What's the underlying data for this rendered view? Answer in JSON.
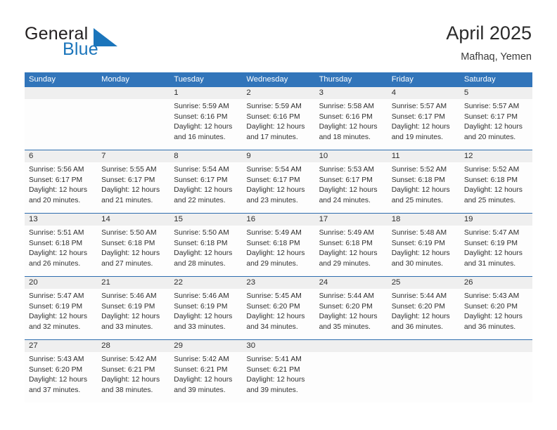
{
  "brand": {
    "name_part1": "General",
    "name_part2": "Blue",
    "mark_color": "#1b75bb"
  },
  "header": {
    "title": "April 2025",
    "location": "Mafhaq, Yemen"
  },
  "theme": {
    "header_blue": "#3275ba",
    "row_divider_blue": "#2e6daf",
    "datebar_gray": "#efefef",
    "cell_white": "#fdfdfd",
    "text": "#2f2f2f"
  },
  "weekdays": [
    "Sunday",
    "Monday",
    "Tuesday",
    "Wednesday",
    "Thursday",
    "Friday",
    "Saturday"
  ],
  "weeks": [
    [
      {
        "day": "",
        "lines": [
          "",
          "",
          "",
          ""
        ]
      },
      {
        "day": "",
        "lines": [
          "",
          "",
          "",
          ""
        ]
      },
      {
        "day": "1",
        "lines": [
          "Sunrise: 5:59 AM",
          "Sunset: 6:16 PM",
          "Daylight: 12 hours",
          "and 16 minutes."
        ]
      },
      {
        "day": "2",
        "lines": [
          "Sunrise: 5:59 AM",
          "Sunset: 6:16 PM",
          "Daylight: 12 hours",
          "and 17 minutes."
        ]
      },
      {
        "day": "3",
        "lines": [
          "Sunrise: 5:58 AM",
          "Sunset: 6:16 PM",
          "Daylight: 12 hours",
          "and 18 minutes."
        ]
      },
      {
        "day": "4",
        "lines": [
          "Sunrise: 5:57 AM",
          "Sunset: 6:17 PM",
          "Daylight: 12 hours",
          "and 19 minutes."
        ]
      },
      {
        "day": "5",
        "lines": [
          "Sunrise: 5:57 AM",
          "Sunset: 6:17 PM",
          "Daylight: 12 hours",
          "and 20 minutes."
        ]
      }
    ],
    [
      {
        "day": "6",
        "lines": [
          "Sunrise: 5:56 AM",
          "Sunset: 6:17 PM",
          "Daylight: 12 hours",
          "and 20 minutes."
        ]
      },
      {
        "day": "7",
        "lines": [
          "Sunrise: 5:55 AM",
          "Sunset: 6:17 PM",
          "Daylight: 12 hours",
          "and 21 minutes."
        ]
      },
      {
        "day": "8",
        "lines": [
          "Sunrise: 5:54 AM",
          "Sunset: 6:17 PM",
          "Daylight: 12 hours",
          "and 22 minutes."
        ]
      },
      {
        "day": "9",
        "lines": [
          "Sunrise: 5:54 AM",
          "Sunset: 6:17 PM",
          "Daylight: 12 hours",
          "and 23 minutes."
        ]
      },
      {
        "day": "10",
        "lines": [
          "Sunrise: 5:53 AM",
          "Sunset: 6:17 PM",
          "Daylight: 12 hours",
          "and 24 minutes."
        ]
      },
      {
        "day": "11",
        "lines": [
          "Sunrise: 5:52 AM",
          "Sunset: 6:18 PM",
          "Daylight: 12 hours",
          "and 25 minutes."
        ]
      },
      {
        "day": "12",
        "lines": [
          "Sunrise: 5:52 AM",
          "Sunset: 6:18 PM",
          "Daylight: 12 hours",
          "and 25 minutes."
        ]
      }
    ],
    [
      {
        "day": "13",
        "lines": [
          "Sunrise: 5:51 AM",
          "Sunset: 6:18 PM",
          "Daylight: 12 hours",
          "and 26 minutes."
        ]
      },
      {
        "day": "14",
        "lines": [
          "Sunrise: 5:50 AM",
          "Sunset: 6:18 PM",
          "Daylight: 12 hours",
          "and 27 minutes."
        ]
      },
      {
        "day": "15",
        "lines": [
          "Sunrise: 5:50 AM",
          "Sunset: 6:18 PM",
          "Daylight: 12 hours",
          "and 28 minutes."
        ]
      },
      {
        "day": "16",
        "lines": [
          "Sunrise: 5:49 AM",
          "Sunset: 6:18 PM",
          "Daylight: 12 hours",
          "and 29 minutes."
        ]
      },
      {
        "day": "17",
        "lines": [
          "Sunrise: 5:49 AM",
          "Sunset: 6:18 PM",
          "Daylight: 12 hours",
          "and 29 minutes."
        ]
      },
      {
        "day": "18",
        "lines": [
          "Sunrise: 5:48 AM",
          "Sunset: 6:19 PM",
          "Daylight: 12 hours",
          "and 30 minutes."
        ]
      },
      {
        "day": "19",
        "lines": [
          "Sunrise: 5:47 AM",
          "Sunset: 6:19 PM",
          "Daylight: 12 hours",
          "and 31 minutes."
        ]
      }
    ],
    [
      {
        "day": "20",
        "lines": [
          "Sunrise: 5:47 AM",
          "Sunset: 6:19 PM",
          "Daylight: 12 hours",
          "and 32 minutes."
        ]
      },
      {
        "day": "21",
        "lines": [
          "Sunrise: 5:46 AM",
          "Sunset: 6:19 PM",
          "Daylight: 12 hours",
          "and 33 minutes."
        ]
      },
      {
        "day": "22",
        "lines": [
          "Sunrise: 5:46 AM",
          "Sunset: 6:19 PM",
          "Daylight: 12 hours",
          "and 33 minutes."
        ]
      },
      {
        "day": "23",
        "lines": [
          "Sunrise: 5:45 AM",
          "Sunset: 6:20 PM",
          "Daylight: 12 hours",
          "and 34 minutes."
        ]
      },
      {
        "day": "24",
        "lines": [
          "Sunrise: 5:44 AM",
          "Sunset: 6:20 PM",
          "Daylight: 12 hours",
          "and 35 minutes."
        ]
      },
      {
        "day": "25",
        "lines": [
          "Sunrise: 5:44 AM",
          "Sunset: 6:20 PM",
          "Daylight: 12 hours",
          "and 36 minutes."
        ]
      },
      {
        "day": "26",
        "lines": [
          "Sunrise: 5:43 AM",
          "Sunset: 6:20 PM",
          "Daylight: 12 hours",
          "and 36 minutes."
        ]
      }
    ],
    [
      {
        "day": "27",
        "lines": [
          "Sunrise: 5:43 AM",
          "Sunset: 6:20 PM",
          "Daylight: 12 hours",
          "and 37 minutes."
        ]
      },
      {
        "day": "28",
        "lines": [
          "Sunrise: 5:42 AM",
          "Sunset: 6:21 PM",
          "Daylight: 12 hours",
          "and 38 minutes."
        ]
      },
      {
        "day": "29",
        "lines": [
          "Sunrise: 5:42 AM",
          "Sunset: 6:21 PM",
          "Daylight: 12 hours",
          "and 39 minutes."
        ]
      },
      {
        "day": "30",
        "lines": [
          "Sunrise: 5:41 AM",
          "Sunset: 6:21 PM",
          "Daylight: 12 hours",
          "and 39 minutes."
        ]
      },
      {
        "day": "",
        "lines": [
          "",
          "",
          "",
          ""
        ]
      },
      {
        "day": "",
        "lines": [
          "",
          "",
          "",
          ""
        ]
      },
      {
        "day": "",
        "lines": [
          "",
          "",
          "",
          ""
        ]
      }
    ]
  ]
}
